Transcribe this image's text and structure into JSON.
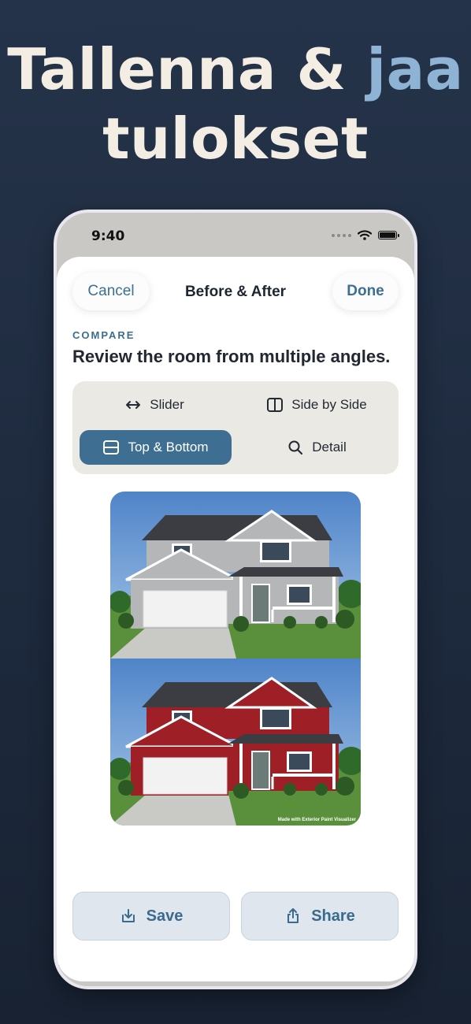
{
  "headline": {
    "line1_main": "Tallenna &",
    "line1_accent": "jaa",
    "line2": "tulokset"
  },
  "status": {
    "time": "9:40"
  },
  "nav": {
    "cancel_label": "Cancel",
    "title": "Before & After",
    "done_label": "Done"
  },
  "section": {
    "label": "COMPARE",
    "title": "Review the room from multiple angles."
  },
  "modes": [
    {
      "label": "Slider",
      "icon": "arrows-horizontal-icon",
      "selected": false
    },
    {
      "label": "Side by Side",
      "icon": "split-columns-icon",
      "selected": false
    },
    {
      "label": "Top & Bottom",
      "icon": "split-rows-icon",
      "selected": true
    },
    {
      "label": "Detail",
      "icon": "magnifier-icon",
      "selected": false
    }
  ],
  "preview": {
    "watermark": "Made with Exterior Paint Visualizer"
  },
  "actions": {
    "save_label": "Save",
    "share_label": "Share"
  },
  "colors": {
    "accent": "#3e6f92",
    "background": "#1f2c40",
    "headline_accent": "#8fb3d4",
    "before_siding": "#b4b6b8",
    "after_siding": "#9e1f26"
  }
}
